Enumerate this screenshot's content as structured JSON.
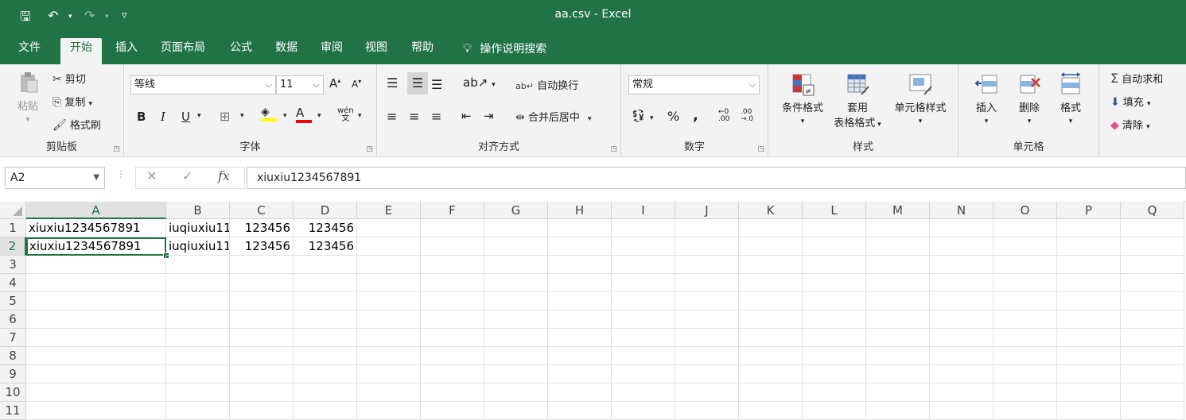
{
  "window": {
    "title": "aa.csv  -  Excel"
  },
  "quick_access": {
    "save": "🖫",
    "undo": "↶",
    "redo": "↷",
    "customize": "▿"
  },
  "tabs": [
    {
      "label": "文件",
      "active": false
    },
    {
      "label": "开始",
      "active": true
    },
    {
      "label": "插入",
      "active": false
    },
    {
      "label": "页面布局",
      "active": false
    },
    {
      "label": "公式",
      "active": false
    },
    {
      "label": "数据",
      "active": false
    },
    {
      "label": "审阅",
      "active": false
    },
    {
      "label": "视图",
      "active": false
    },
    {
      "label": "帮助",
      "active": false
    }
  ],
  "tell_me": "操作说明搜索",
  "ribbon": {
    "clipboard": {
      "label": "剪贴板",
      "paste": "粘贴",
      "cut": "剪切",
      "copy": "复制",
      "format_painter": "格式刷"
    },
    "font": {
      "label": "字体",
      "font_name": "等线",
      "font_size": "11",
      "grow": "A",
      "shrink": "A",
      "bold": "B",
      "italic": "I",
      "underline": "U",
      "phonetic": "wén"
    },
    "alignment": {
      "label": "对齐方式",
      "wrap": "自动换行",
      "merge": "合并后居中"
    },
    "number": {
      "label": "数字",
      "format": "常规",
      "percent": "%",
      "comma": ","
    },
    "styles": {
      "label": "样式",
      "conditional": "条件格式",
      "table_line1": "套用",
      "table_line2": "表格格式",
      "cell_styles": "单元格样式"
    },
    "cells": {
      "label": "单元格",
      "insert": "插入",
      "delete": "删除",
      "format": "格式"
    },
    "editing": {
      "autosum": "自动求和",
      "fill": "填充",
      "clear": "清除"
    }
  },
  "formula_bar": {
    "name_box": "A2",
    "formula": "xiuxiu1234567891",
    "fx": "fx"
  },
  "columns": [
    "A",
    "B",
    "C",
    "D",
    "E",
    "F",
    "G",
    "H",
    "I",
    "J",
    "K",
    "L",
    "M",
    "N",
    "O",
    "P",
    "Q"
  ],
  "rows": [
    "1",
    "2",
    "3",
    "4",
    "5",
    "6",
    "7",
    "8",
    "9",
    "10",
    "11"
  ],
  "cells": [
    {
      "ref": "A1",
      "value": "xiuxiu1234567891",
      "type": "text"
    },
    {
      "ref": "B1",
      "value": "iuqiuxiu11",
      "type": "text"
    },
    {
      "ref": "C1",
      "value": "123456",
      "type": "number"
    },
    {
      "ref": "D1",
      "value": "123456",
      "type": "number"
    },
    {
      "ref": "A2",
      "value": "xiuxiu1234567891",
      "type": "text"
    },
    {
      "ref": "B2",
      "value": "iuqiuxiu11",
      "type": "text"
    },
    {
      "ref": "C2",
      "value": "123456",
      "type": "number"
    },
    {
      "ref": "D2",
      "value": "123456",
      "type": "number"
    }
  ],
  "active_cell": "A2",
  "colors": {
    "accent": "#217346",
    "ribbon_bg": "#f3f3f3"
  }
}
